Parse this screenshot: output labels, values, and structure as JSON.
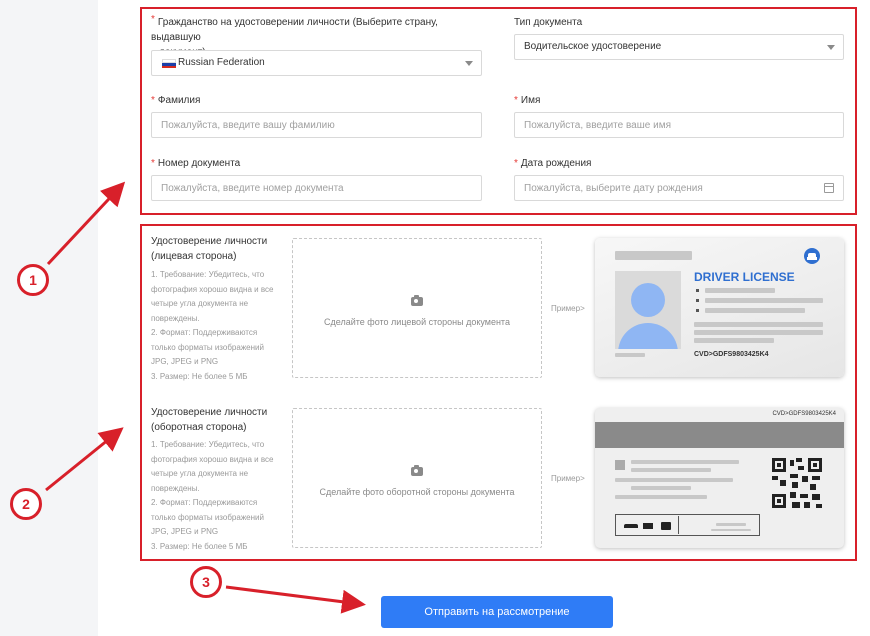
{
  "form": {
    "citizenship_label": "Гражданство на удостоверении личности (Выберите страну, выдавшую",
    "citizenship_label_2": "документ)",
    "citizenship_value": "Russian Federation",
    "doc_type_label": "Тип документа",
    "doc_type_value": "Водительское удостоверение",
    "surname_label": "Фамилия",
    "surname_placeholder": "Пожалуйста, введите вашу фамилию",
    "name_label": "Имя",
    "name_placeholder": "Пожалуйста, введите ваше имя",
    "docnum_label": "Номер документа",
    "docnum_placeholder": "Пожалуйста, введите номер документа",
    "dob_label": "Дата рождения",
    "dob_placeholder": "Пожалуйста, выберите дату рождения",
    "required_mark": "*"
  },
  "uploads": {
    "front": {
      "title_1": "Удостоверение личности",
      "title_2": "(лицевая сторона)",
      "requirements": [
        "1. Требование: Убедитесь, что",
        "фотография хорошо видна и все",
        "четыре угла документа не",
        "повреждены.",
        "2. Формат: Поддерживаются",
        "только форматы изображений",
        "JPG, JPEG и PNG",
        "3. Размер: Не более 5 МБ"
      ],
      "upload_text": "Сделайте фото лицевой стороны документа",
      "example_label": "Пример>"
    },
    "back": {
      "title_1": "Удостоверение личности",
      "title_2": "(оборотная сторона)",
      "requirements": [
        "1. Требование: Убедитесь, что",
        "фотография хорошо видна и все",
        "четыре угла документа не",
        "повреждены.",
        "2. Формат: Поддерживаются",
        "только форматы изображений",
        "JPG, JPEG и PNG",
        "3. Размер: Не более 5 МБ"
      ],
      "upload_text": "Сделайте фото оборотной стороны документа",
      "example_label": "Пример>"
    }
  },
  "example_cards": {
    "front_title": "DRIVER LICENSE",
    "front_code": "CVD>GDFS9803425K4",
    "back_code": "CVD>GDFS9803425K4"
  },
  "submit_label": "Отправить на рассмотрение",
  "annotations": [
    "1",
    "2",
    "3"
  ],
  "colors": {
    "annotation_red": "#d8202a",
    "primary_blue": "#2f7cf6",
    "license_blue": "#2f6fd0",
    "required_red": "#e53935"
  },
  "icons": {
    "upload": "camera-icon",
    "select": "chevron-down-icon",
    "date": "calendar-icon",
    "flag": "russia-flag-icon"
  }
}
